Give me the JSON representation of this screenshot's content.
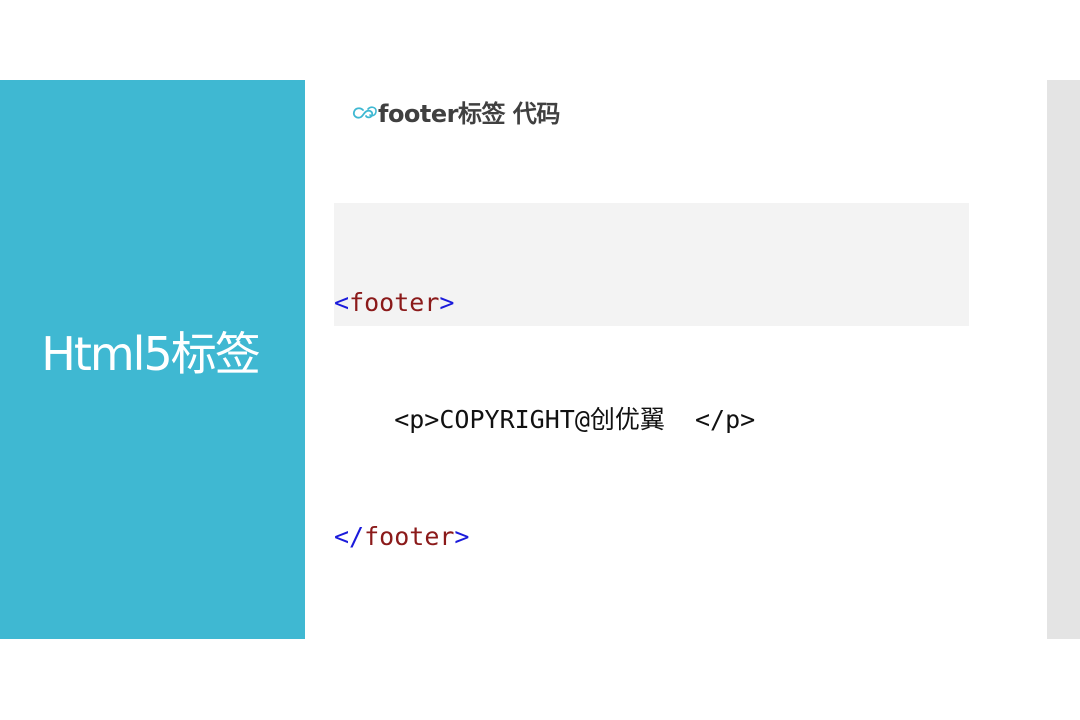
{
  "slide": {
    "section_title": "Html5标签",
    "heading": "footer标签 代码",
    "bullet_icon": "curl-bullet-icon",
    "colors": {
      "accent": "#3fb8d2",
      "side_strip": "#e4e4e4",
      "code_bg": "#f3f3f3",
      "code_punct": "#1a1adb",
      "code_tag": "#8b1a1a"
    },
    "code": {
      "open_lt": "<",
      "open_tag": "footer",
      "open_gt": ">",
      "inner_line": "    <p>COPYRIGHT@创优翼  </p>",
      "close_lt": "</",
      "close_tag": "footer",
      "close_gt": ">"
    }
  }
}
